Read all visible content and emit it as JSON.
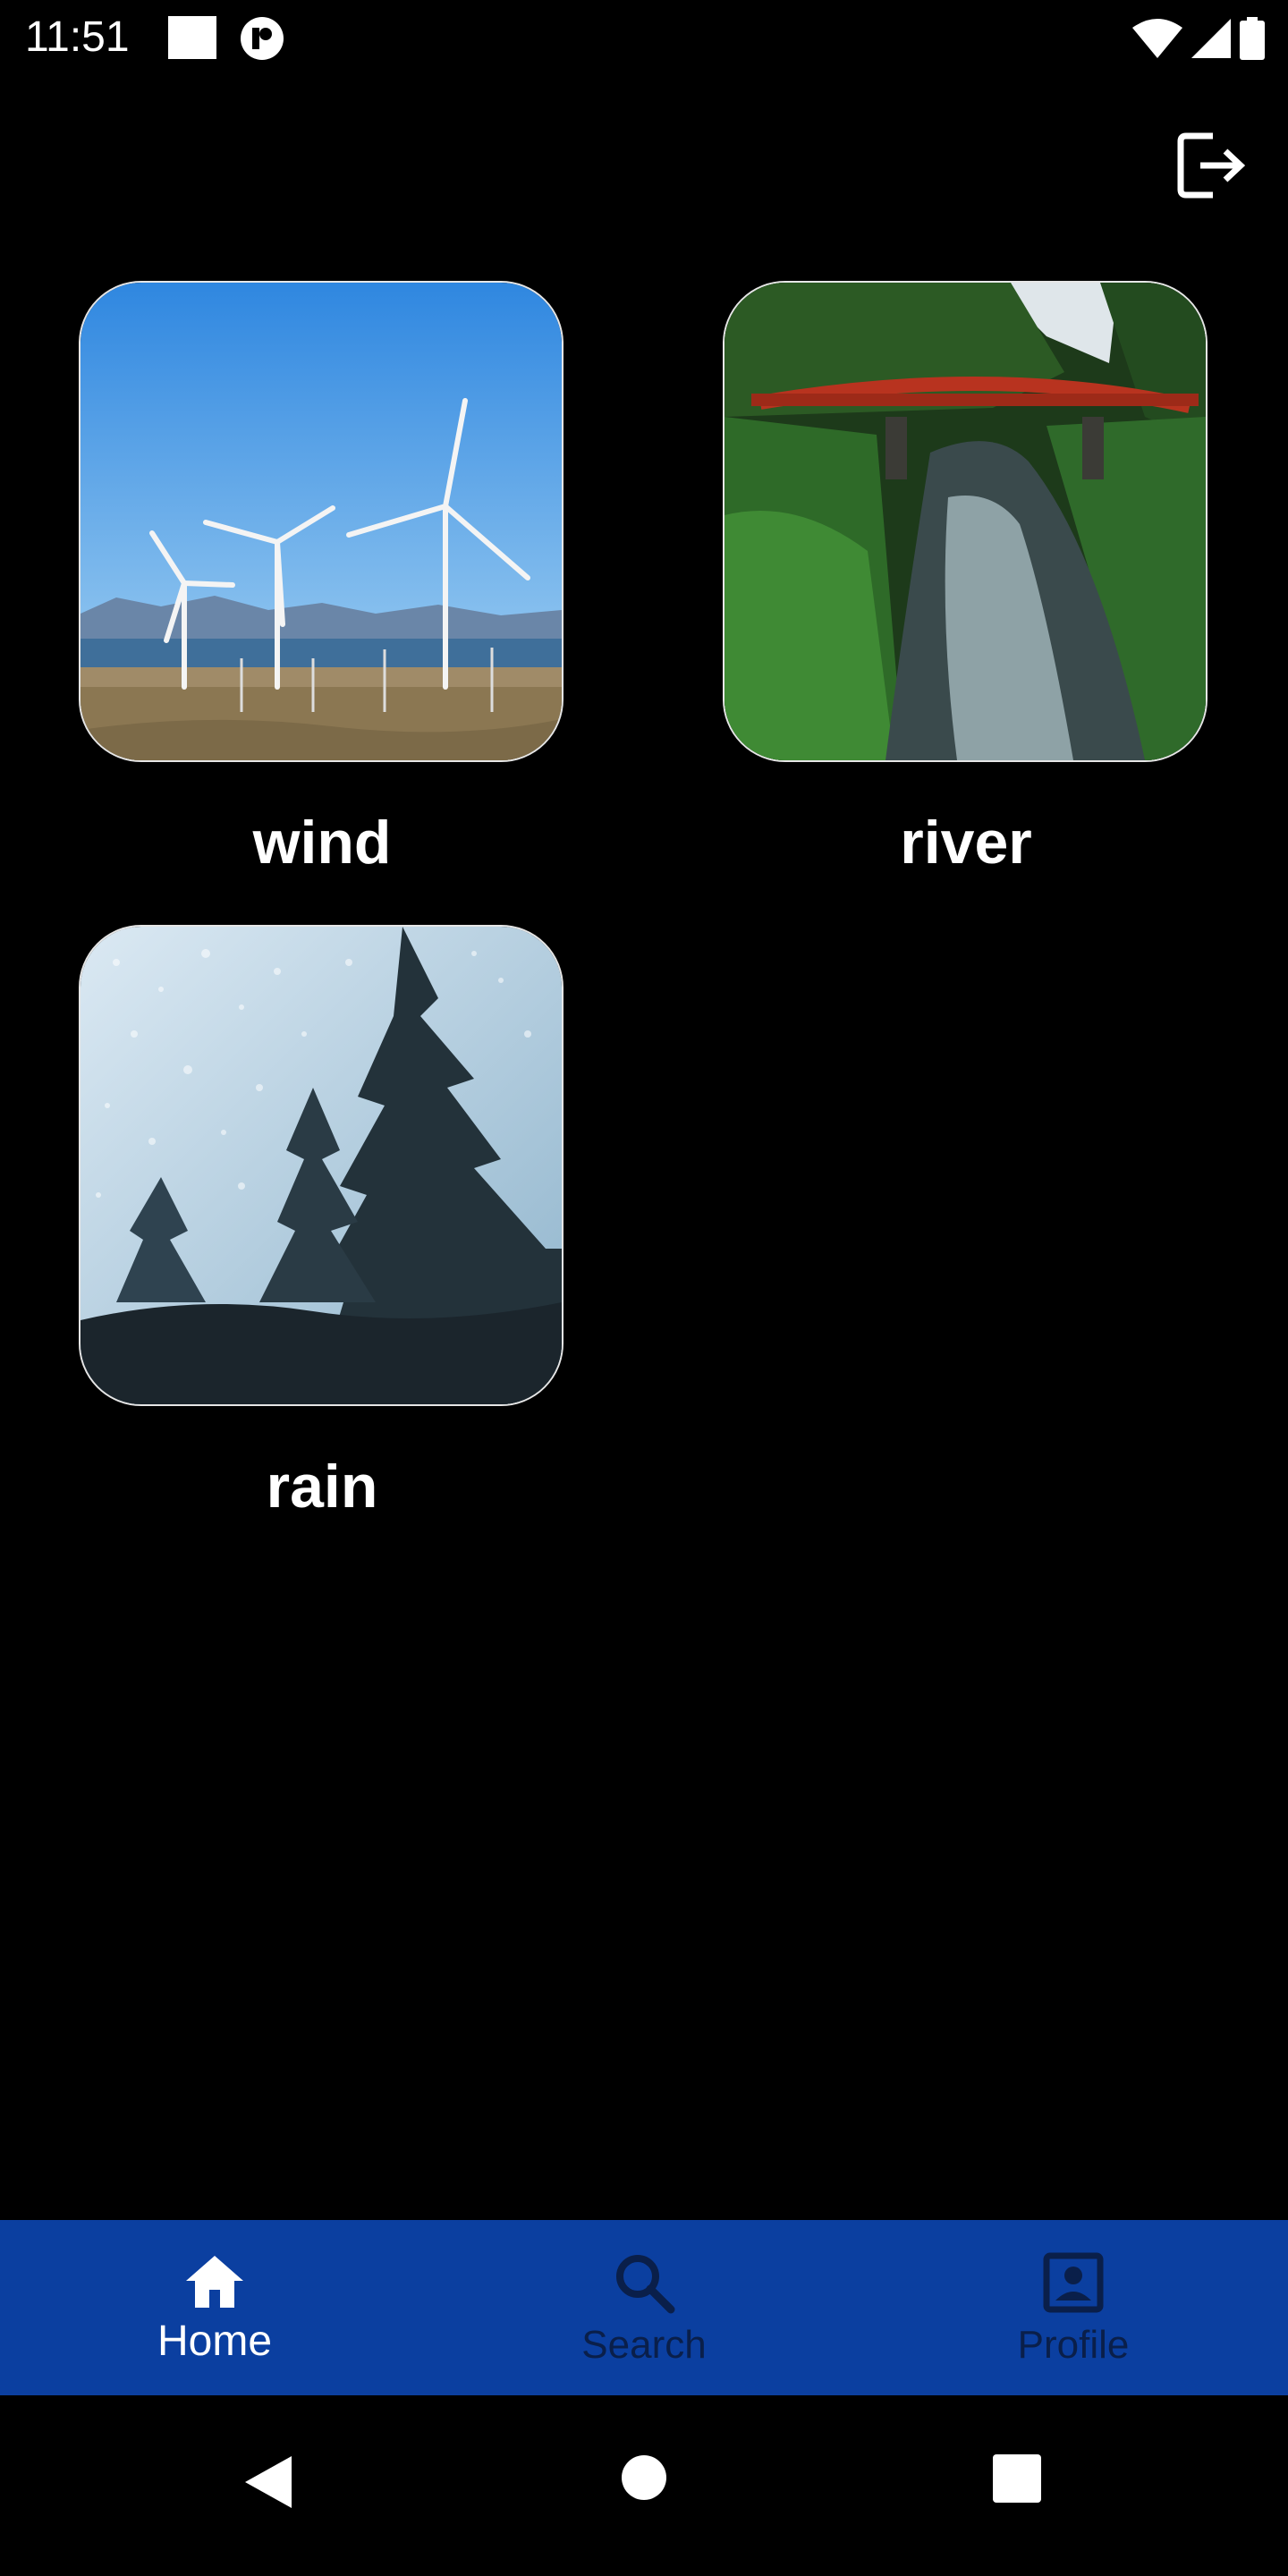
{
  "status_bar": {
    "time": "11:51"
  },
  "header": {
    "logout_icon": "logout-icon"
  },
  "grid": {
    "items": [
      {
        "label": "wind",
        "image": "wind-turbines-photo"
      },
      {
        "label": "river",
        "image": "river-bridge-photo"
      },
      {
        "label": "rain",
        "image": "rain-window-trees-photo"
      }
    ]
  },
  "bottom_nav": {
    "background_color": "#0b3fa0",
    "items": [
      {
        "label": "Home",
        "icon": "home-icon",
        "active": true
      },
      {
        "label": "Search",
        "icon": "search-icon",
        "active": false
      },
      {
        "label": "Profile",
        "icon": "profile-icon",
        "active": false
      }
    ]
  },
  "system_nav": {
    "back": "back-icon",
    "home": "home-circle-icon",
    "recents": "recents-icon"
  }
}
